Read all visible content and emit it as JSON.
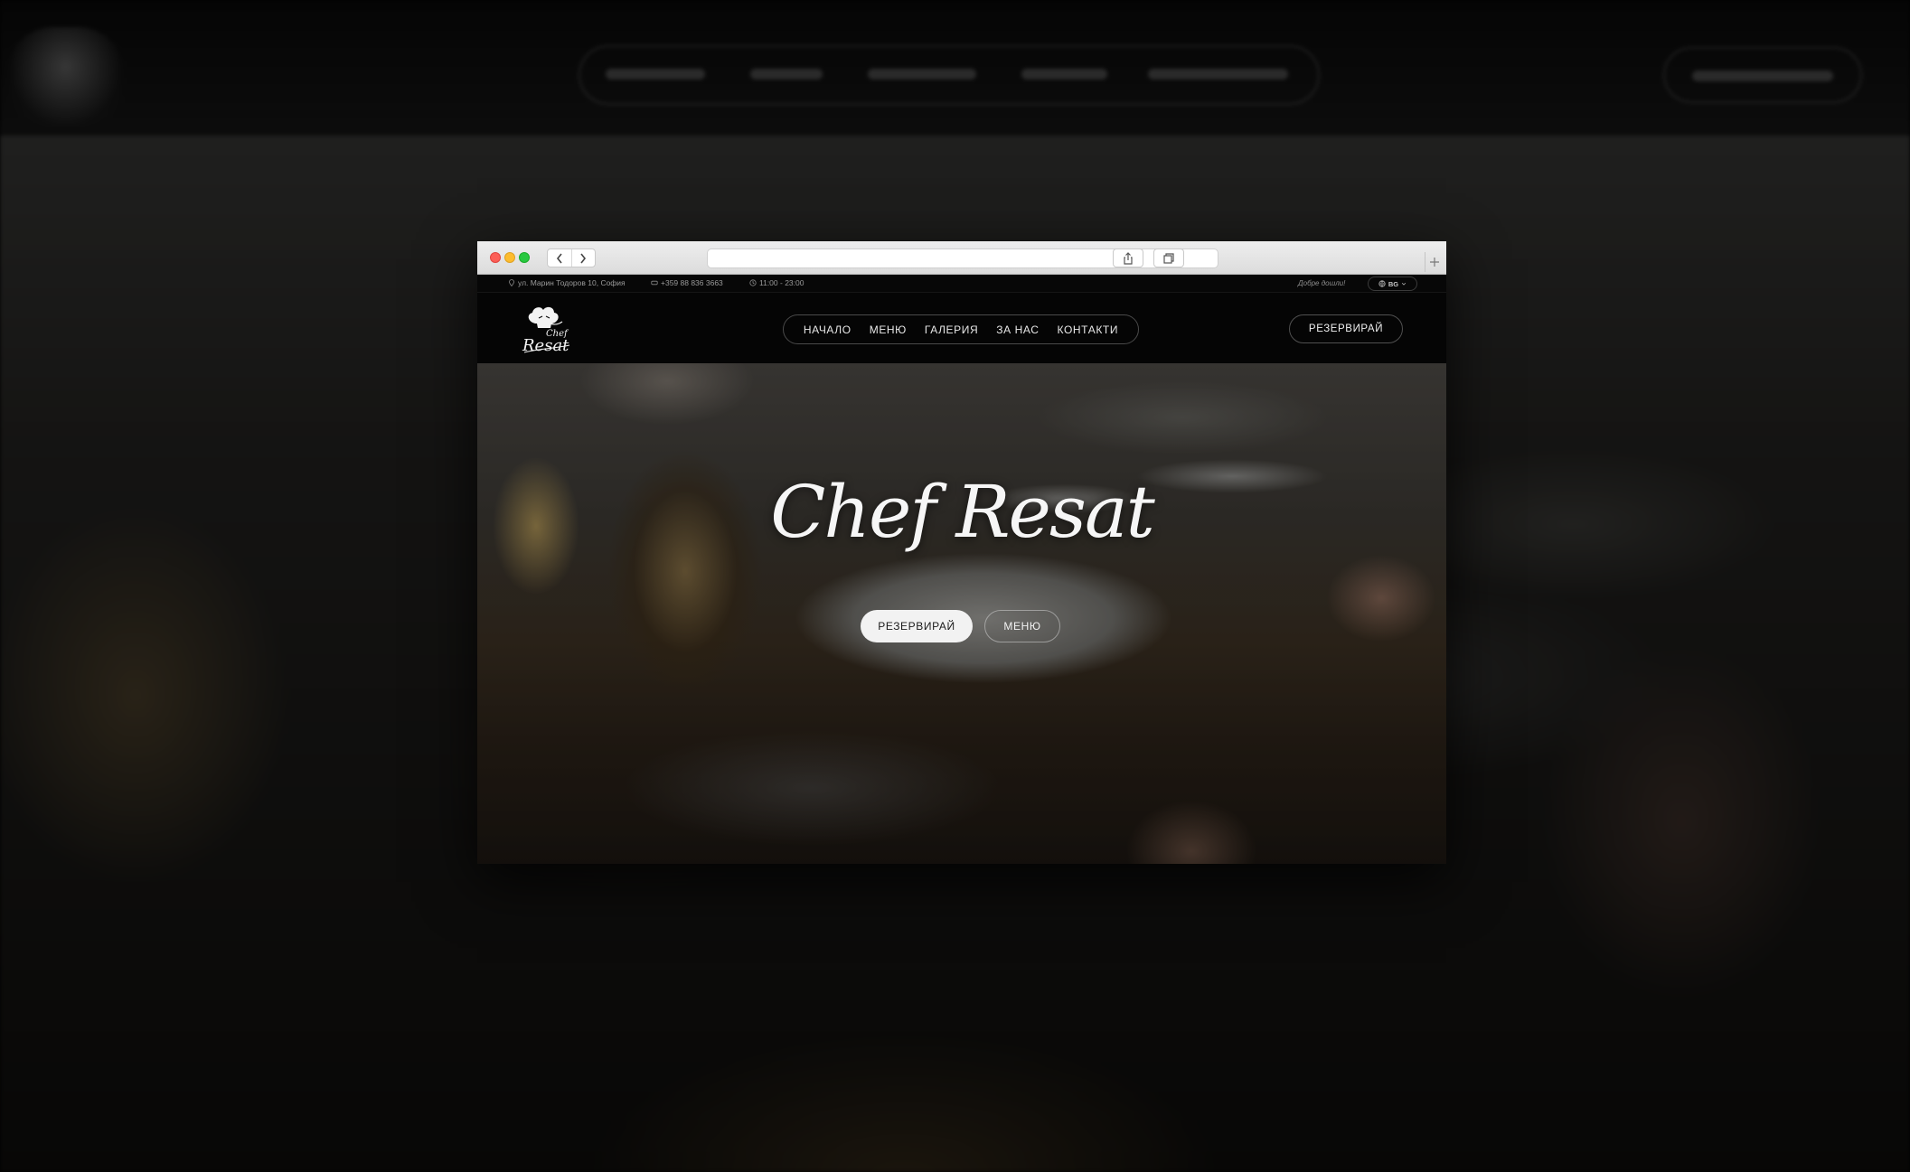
{
  "topbar": {
    "address": "ул. Марин Тодоров 10, София",
    "phone": "+359 88 836 3663",
    "hours": "11:00 - 23:00",
    "welcome": "Добре дошли!",
    "language": "BG"
  },
  "header": {
    "logo_text": "Chef Resat",
    "nav": [
      "НАЧАЛО",
      "МЕНЮ",
      "ГАЛЕРИЯ",
      "ЗА НАС",
      "КОНТАКТИ"
    ],
    "reserve_label": "РЕЗЕРВИРАЙ"
  },
  "hero": {
    "title": "Chef Resat",
    "reserve_label": "РЕЗЕРВИРАЙ",
    "menu_label": "МЕНЮ"
  },
  "browser": {
    "url": ""
  },
  "icons": {
    "back": "chevron-left-icon",
    "forward": "chevron-right-icon",
    "share": "share-icon",
    "tabs": "tabs-icon",
    "new_tab": "plus-icon",
    "location": "location-pin-icon",
    "phone": "phone-icon",
    "clock": "clock-icon",
    "globe": "globe-icon",
    "chevron": "chevron-down-icon"
  },
  "colors": {
    "traffic_red": "#fc5f57",
    "traffic_yellow": "#fdbc2e",
    "traffic_green": "#28c840",
    "page_bg": "#050505",
    "accent_light": "#f2f2f2"
  }
}
